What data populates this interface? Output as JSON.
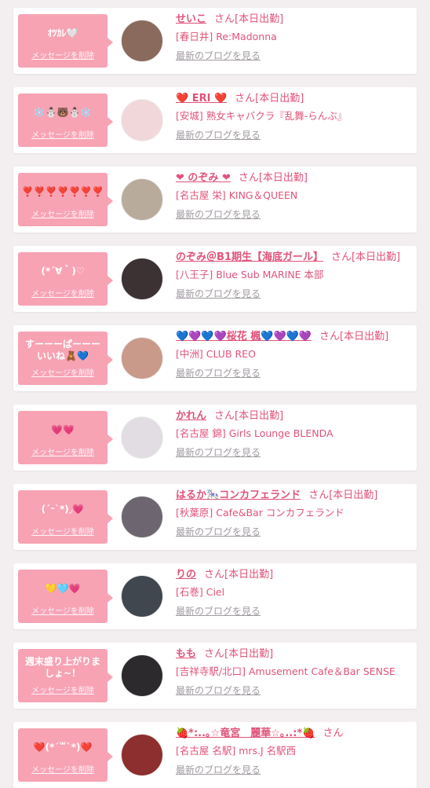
{
  "cards": [
    {
      "message": "ｵﾂｶﾚ🤍",
      "delete_label": "メッセージを削除",
      "name": "せいこ",
      "suffix": "さん[本日出勤]",
      "store": "[春日井] Re:Madonna",
      "blog_label": "最新のブログを見る",
      "avatar_color": "#8a6a5c"
    },
    {
      "message": "❄️⛄🐻⛄❄️",
      "delete_label": "メッセージを削除",
      "name": "❤️ ERI ❤️",
      "suffix": "さん[本日出勤]",
      "store": "[安城] 熟女キャバクラ『乱舞-らんぶ』",
      "blog_label": "最新のブログを見る",
      "avatar_color": "#f1d7da"
    },
    {
      "message": "❣️❣️❣️❣️❣️❣️❣️",
      "delete_label": "メッセージを削除",
      "name": "❤ のぞみ ❤",
      "suffix": "さん[本日出勤]",
      "store": "[名古屋 栄] KING＆QUEEN",
      "blog_label": "最新のブログを見る",
      "avatar_color": "#b9ab9c"
    },
    {
      "message": "(*´∀｀)♡",
      "delete_label": "メッセージを削除",
      "name": "のぞみ＠B1期生【海底ガール】",
      "suffix": "さん[本日出勤]",
      "store": "[八王子] Blue Sub MARINE 本部",
      "blog_label": "最新のブログを見る",
      "avatar_color": "#3c3234"
    },
    {
      "message": "すーーーぱーーーいいね🧸💙",
      "delete_label": "メッセージを削除",
      "name": "💙💜💙💜桜花 楓💙💜💙💜",
      "suffix": "さん[本日出勤]",
      "store": "[中洲] CLUB REO",
      "blog_label": "最新のブログを見る",
      "avatar_color": "#c99a8a"
    },
    {
      "message": "💗💗",
      "delete_label": "メッセージを削除",
      "name": "かれん",
      "suffix": "さん[本日出勤]",
      "store": "[名古屋 錦] Girls Lounge BLENDA",
      "blog_label": "最新のブログを見る",
      "avatar_color": "#e2dde2"
    },
    {
      "message": "(ˊᵕˋ*)◞💗",
      "delete_label": "メッセージを削除",
      "name": "はるか🎠コンカフェランド",
      "suffix": "さん[本日出勤]",
      "store": "[秋葉原] Cafe&Bar コンカフェランド",
      "blog_label": "最新のブログを見る",
      "avatar_color": "#6d6670"
    },
    {
      "message": "💛🩵💗",
      "delete_label": "メッセージを削除",
      "name": "りの",
      "suffix": "さん[本日出勤]",
      "store": "[石巻] Ciel",
      "blog_label": "最新のブログを見る",
      "avatar_color": "#40474e"
    },
    {
      "message": "週末盛り上がりましょ~！",
      "delete_label": "メッセージを削除",
      "name": "もも",
      "suffix": "さん[本日出勤]",
      "store": "[吉祥寺駅/北口] Amusement Cafe＆Bar SENSE",
      "blog_label": "最新のブログを見る",
      "avatar_color": "#2c2a2c"
    },
    {
      "message": "❤️(*´꒳`*)❤️",
      "delete_label": "メッセージを削除",
      "name": "🍓*:..｡☆竜宮　麗華☆｡..:*🍓",
      "suffix": "さん",
      "store": "[名古屋 名駅] mrs.J 名駅西",
      "blog_label": "最新のブログを見る",
      "avatar_color": "#8d2f2f"
    }
  ]
}
